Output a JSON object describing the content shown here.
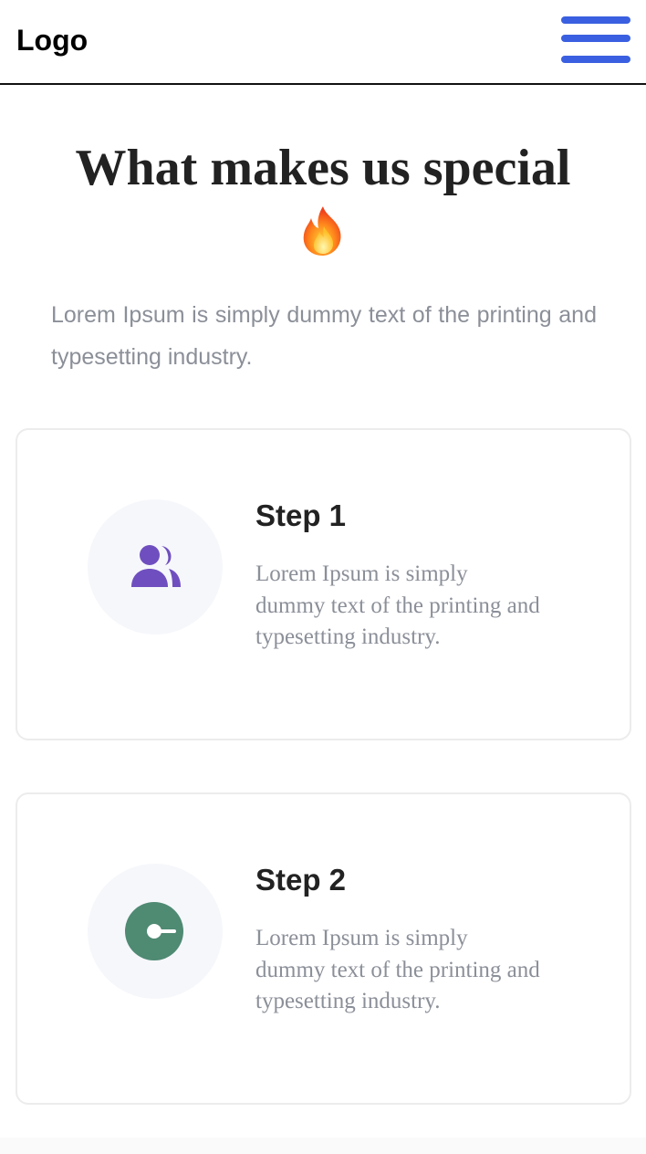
{
  "header": {
    "logo": "Logo",
    "menu_icon": "hamburger-menu-icon",
    "menu_color": "#3a5fe0"
  },
  "hero": {
    "title": "What makes us special",
    "emoji_icon": "fire-icon",
    "intro": "Lorem Ipsum is simply dummy text of the printing and typesetting industry."
  },
  "steps": [
    {
      "title": "Step 1",
      "icon": "users-icon",
      "icon_color": "#6f4fbf",
      "text_lines": [
        "Lorem Ipsum is simply",
        "dummy text of the printing and",
        "typesetting industry."
      ]
    },
    {
      "title": "Step 2",
      "icon": "disc-icon",
      "icon_color": "#4f8a73",
      "text_lines": [
        "Lorem Ipsum is simply",
        "dummy text of the printing and",
        "typesetting industry."
      ]
    }
  ]
}
